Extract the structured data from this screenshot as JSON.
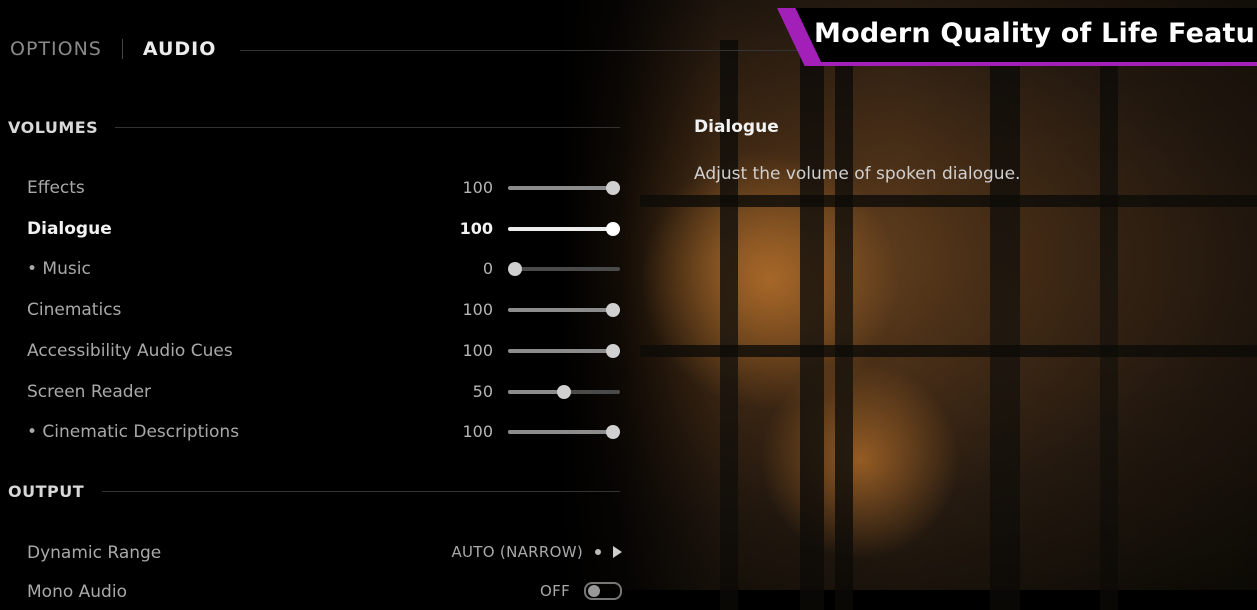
{
  "header": {
    "tabs": [
      {
        "label": "OPTIONS"
      },
      {
        "label": "AUDIO"
      }
    ]
  },
  "volumes": {
    "section_title": "VOLUMES",
    "items": [
      {
        "label": "Effects",
        "value": "100",
        "level": 1.0
      },
      {
        "label": "Dialogue",
        "value": "100",
        "level": 1.0,
        "selected": true
      },
      {
        "label": "• Music",
        "value": "0",
        "level": 0.0
      },
      {
        "label": "Cinematics",
        "value": "100",
        "level": 1.0
      },
      {
        "label": "Accessibility Audio Cues",
        "value": "100",
        "level": 1.0
      },
      {
        "label": "Screen Reader",
        "value": "50",
        "level": 0.5
      },
      {
        "label": "• Cinematic Descriptions",
        "value": "100",
        "level": 1.0
      }
    ]
  },
  "output": {
    "section_title": "OUTPUT",
    "dynamic_range": {
      "label": "Dynamic Range",
      "value": "AUTO (NARROW)"
    },
    "mono_audio": {
      "label": "Mono Audio",
      "value": "OFF"
    }
  },
  "description": {
    "title": "Dialogue",
    "text": "Adjust the volume of spoken dialogue."
  },
  "banner": {
    "text": "Modern Quality of Life Features",
    "accent_color": "#a21fb8"
  }
}
